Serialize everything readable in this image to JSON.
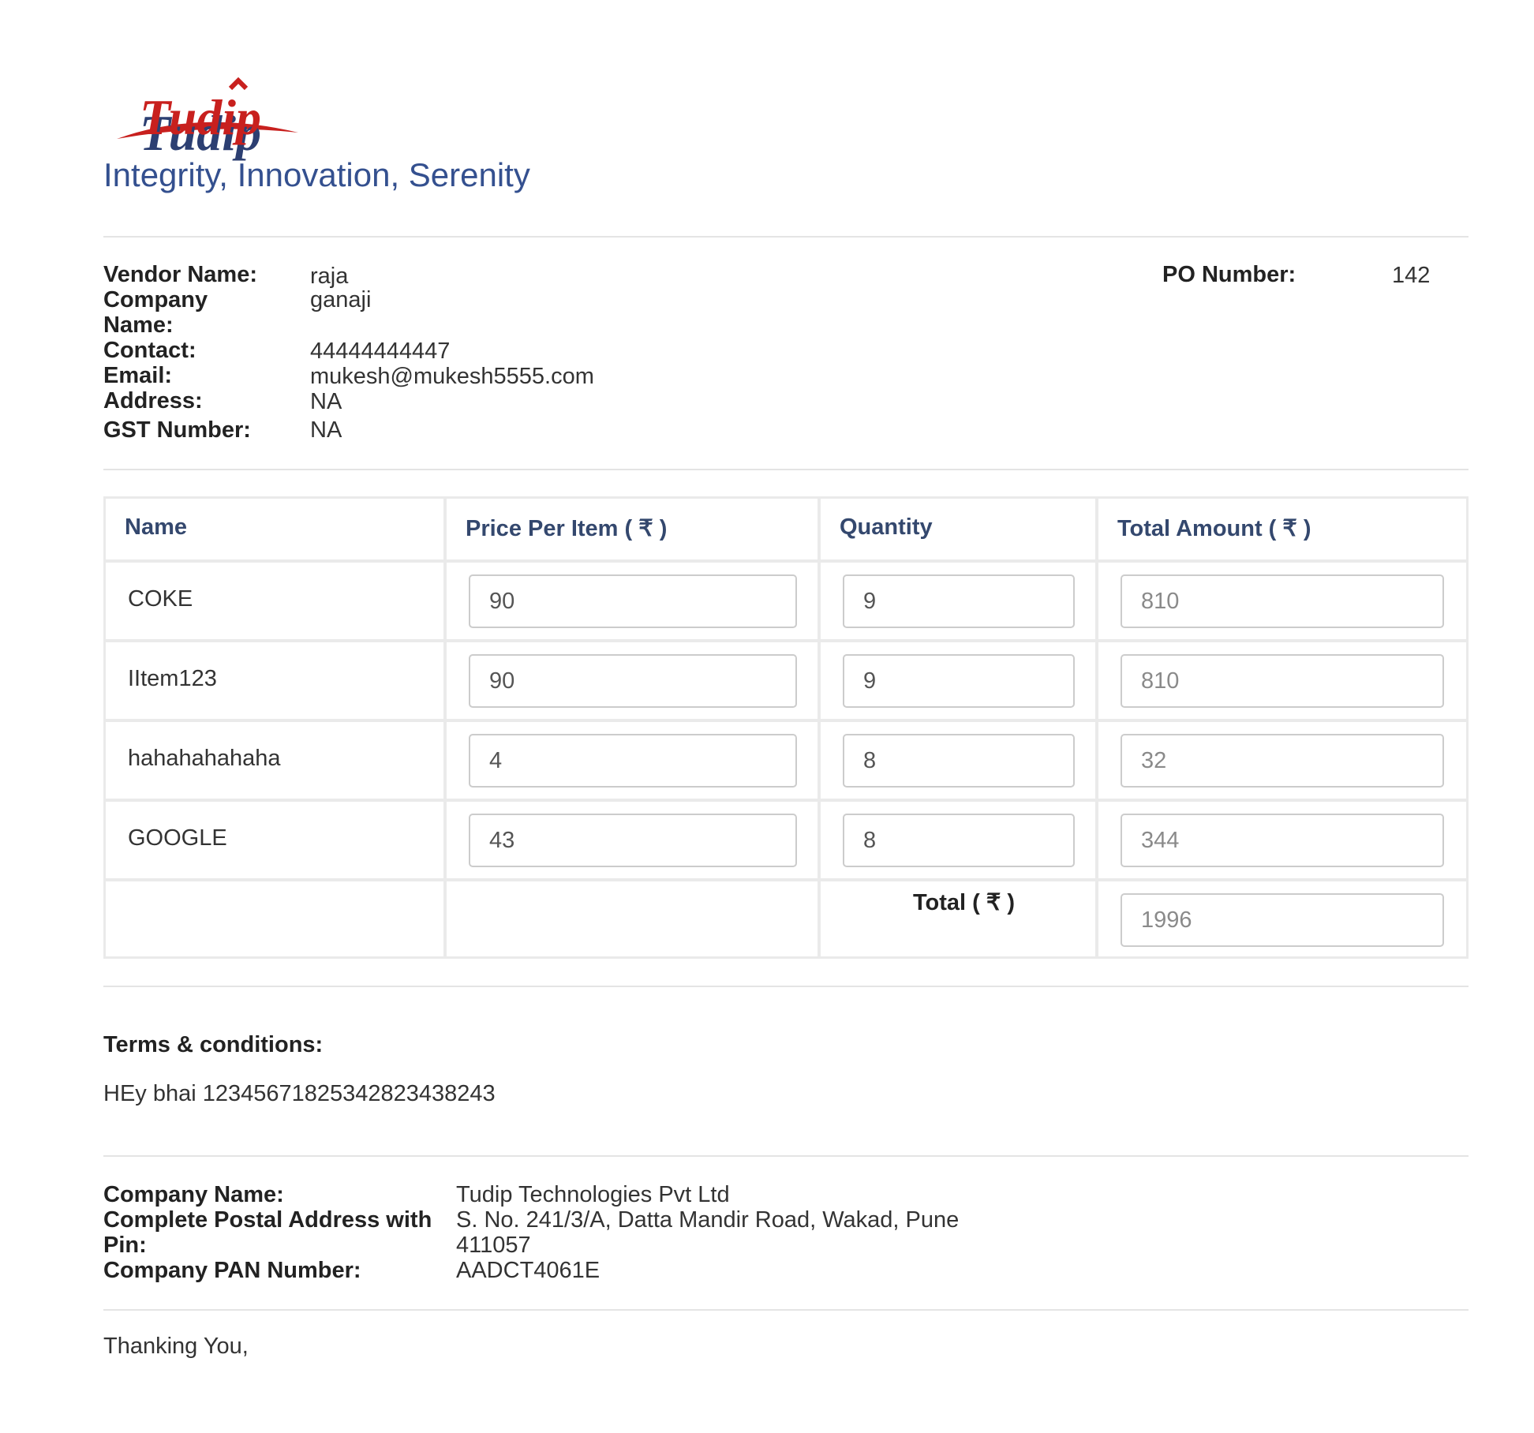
{
  "header": {
    "logo_text": "Tudip",
    "tagline": "Integrity, Innovation, Serenity"
  },
  "vendor": {
    "name_label": "Vendor Name:",
    "name_value": "raja",
    "company_label_line1": "Company",
    "company_label_line2": "Name:",
    "company_value": "ganaji",
    "contact_label": "Contact:",
    "contact_value": "44444444447",
    "email_label": "Email:",
    "email_value": "mukesh@mukesh5555.com",
    "address_label": "Address:",
    "address_value": "NA",
    "gst_label": "GST Number:",
    "gst_value": "NA",
    "po_label": "PO Number:",
    "po_value": "142"
  },
  "table": {
    "headers": {
      "name": "Name",
      "price": "Price Per Item ( ₹ )",
      "quantity": "Quantity",
      "total": "Total Amount ( ₹ )"
    },
    "rows": [
      {
        "name": "COKE",
        "price": "90",
        "quantity": "9",
        "total": "810"
      },
      {
        "name": "IItem123",
        "price": "90",
        "quantity": "9",
        "total": "810"
      },
      {
        "name": "hahahahahaha",
        "price": "4",
        "quantity": "8",
        "total": "32"
      },
      {
        "name": "GOOGLE",
        "price": "43",
        "quantity": "8",
        "total": "344"
      }
    ],
    "total_label": "Total ( ₹ )",
    "grand_total": "1996"
  },
  "terms": {
    "heading": "Terms & conditions:",
    "text": "HEy bhai 12345671825342823438243"
  },
  "company": {
    "name_label": "Company Name:",
    "name_value": "Tudip Technologies Pvt Ltd",
    "address_label_line1": "Complete Postal Address with",
    "address_label_line2": "Pin:",
    "address_value_line1": "S. No. 241/3/A, Datta Mandir Road, Wakad, Pune",
    "address_value_line2": "411057",
    "pan_label": "Company PAN Number:",
    "pan_value": "AADCT4061E"
  },
  "footer": {
    "thanks": "Thanking You,"
  },
  "colors": {
    "brand_red": "#c8201e",
    "brand_blue": "#2c3f72",
    "tagline_blue": "#34508f",
    "header_text": "#34486e"
  }
}
